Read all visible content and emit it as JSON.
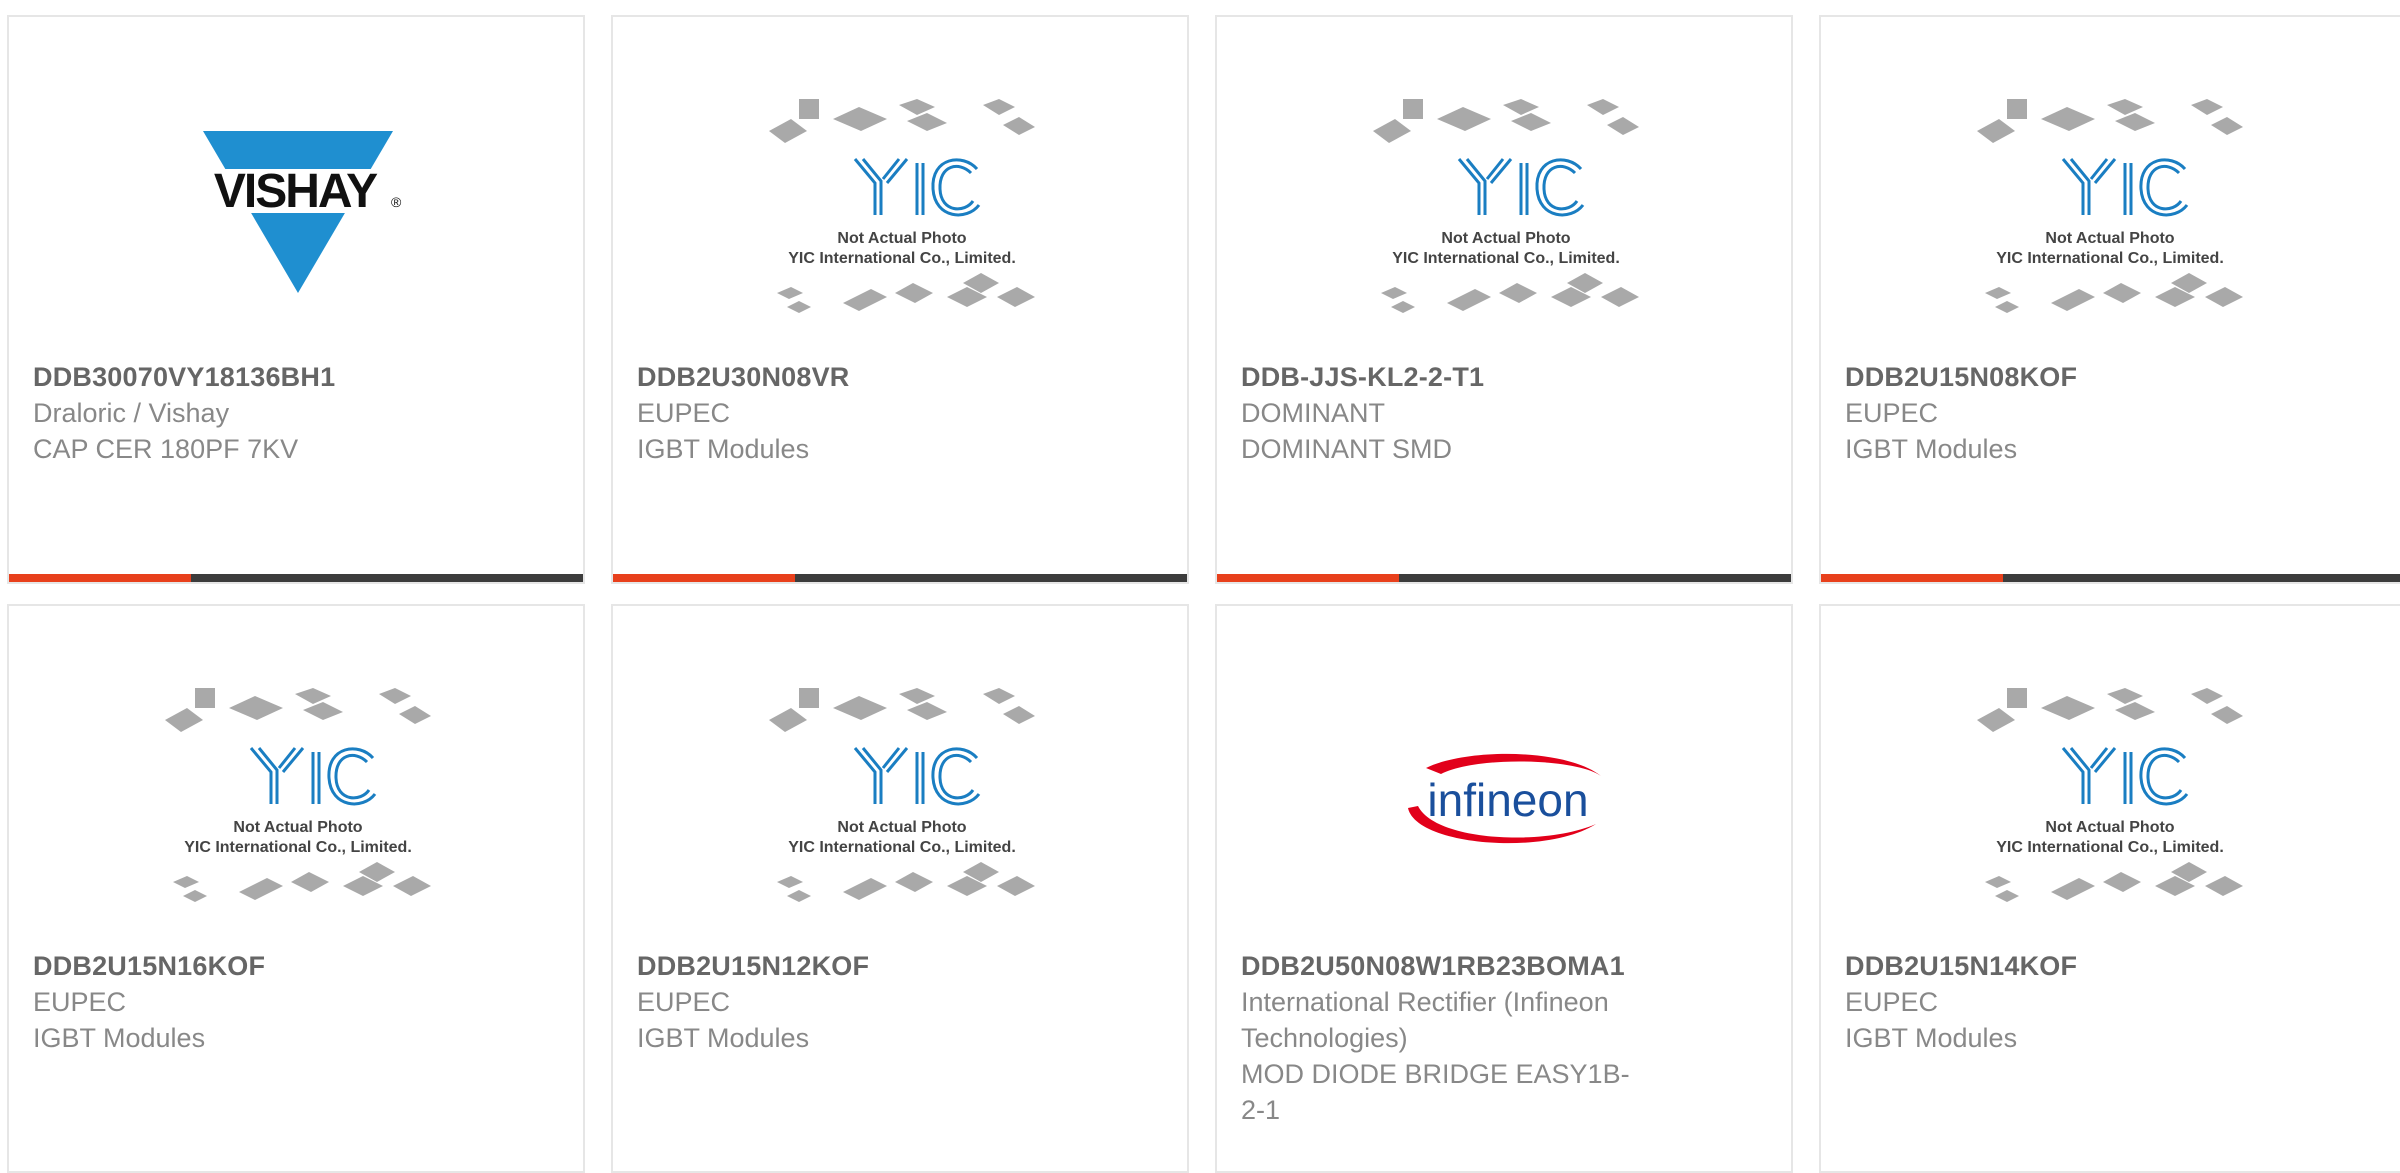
{
  "accent_colors": {
    "progress_orange": "#e8401c",
    "progress_dark": "#3c3c3c",
    "yic_blue": "#1a7ec2",
    "vishay_blue": "#1f8fd0",
    "infineon_red": "#e2001a"
  },
  "products": [
    {
      "part_number": "DDB30070VY18136BH1",
      "manufacturer": "Draloric / Vishay",
      "description": "CAP CER 180PF 7KV",
      "image": "vishay-logo",
      "logo_text": "VISHAY",
      "logo_mark": "®"
    },
    {
      "part_number": "DDB2U30N08VR",
      "manufacturer": "EUPEC",
      "description": "IGBT Modules",
      "image": "yic-placeholder",
      "logo_text": "YIC",
      "caption1": "Not Actual Photo",
      "caption2": "YIC International Co., Limited."
    },
    {
      "part_number": "DDB-JJS-KL2-2-T1",
      "manufacturer": "DOMINANT",
      "description": "DOMINANT SMD",
      "image": "yic-placeholder",
      "logo_text": "YIC",
      "caption1": "Not Actual Photo",
      "caption2": "YIC International Co., Limited."
    },
    {
      "part_number": "DDB2U15N08KOF",
      "manufacturer": "EUPEC",
      "description": "IGBT Modules",
      "image": "yic-placeholder",
      "logo_text": "YIC",
      "caption1": "Not Actual Photo",
      "caption2": "YIC International Co., Limited."
    },
    {
      "part_number": "DDB2U15N16KOF",
      "manufacturer": "EUPEC",
      "description": "IGBT Modules",
      "image": "yic-placeholder",
      "logo_text": "YIC",
      "caption1": "Not Actual Photo",
      "caption2": "YIC International Co., Limited."
    },
    {
      "part_number": "DDB2U15N12KOF",
      "manufacturer": "EUPEC",
      "description": "IGBT Modules",
      "image": "yic-placeholder",
      "logo_text": "YIC",
      "caption1": "Not Actual Photo",
      "caption2": "YIC International Co., Limited."
    },
    {
      "part_number": "DDB2U50N08W1RB23BOMA1",
      "manufacturer": "International Rectifier (Infineon Technologies)",
      "description": "MOD DIODE BRIDGE EASY1B-2-1",
      "image": "infineon-logo",
      "logo_text": "infineon"
    },
    {
      "part_number": "DDB2U15N14KOF",
      "manufacturer": "EUPEC",
      "description": "IGBT Modules",
      "image": "yic-placeholder",
      "logo_text": "YIC",
      "caption1": "Not Actual Photo",
      "caption2": "YIC International Co., Limited."
    }
  ]
}
